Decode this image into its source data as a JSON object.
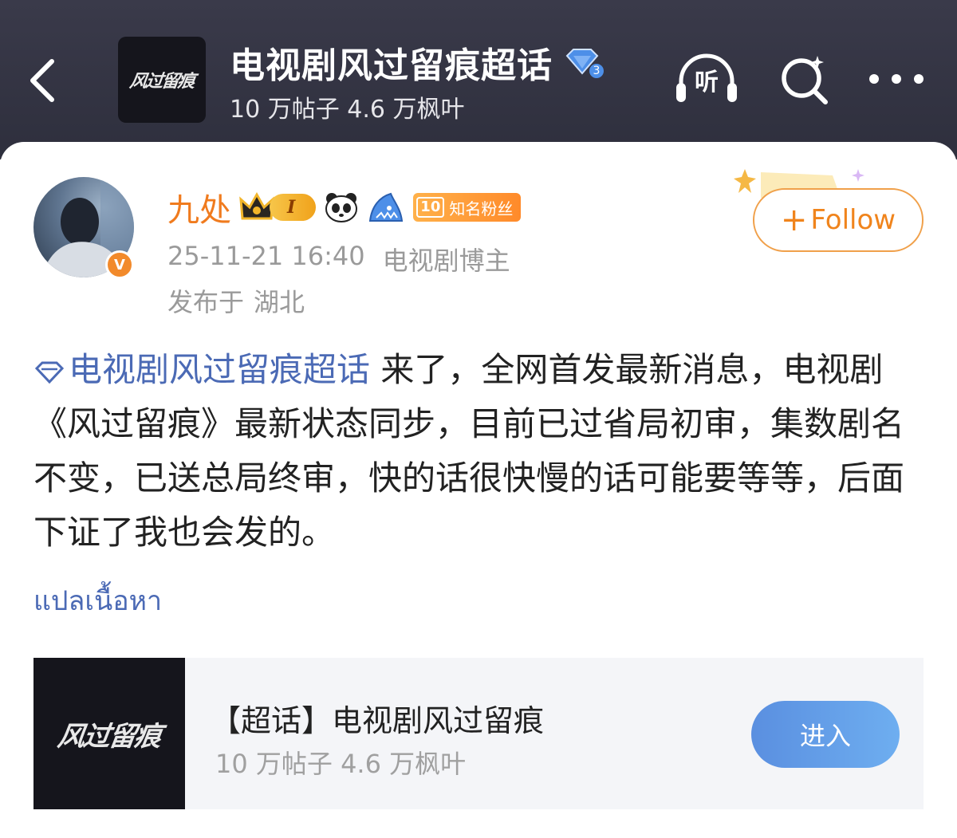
{
  "header": {
    "logo_text": "风过留痕",
    "title": "电视剧风过留痕超话",
    "level_badge": "3",
    "stats": "10 万帖子 4.6 万枫叶"
  },
  "post": {
    "author": "九处",
    "crown_level": "I",
    "fan_badge_level": "10",
    "fan_badge_label": "知名粉丝",
    "verified_mark": "V",
    "timestamp": "25-11-21 16:40",
    "author_tag": "电视剧博主",
    "location_prefix": "发布于",
    "location": "湖北",
    "follow_plus": "+",
    "follow_label": "Follow",
    "topic_link": "电视剧风过留痕超话",
    "body": " 来了，全网首发最新消息，电视剧《风过留痕》最新状态同步，目前已过省局初审，集数剧名不变，已送总局终审，快的话很快慢的话可能要等等，后面下证了我也会发的。",
    "translate_label": "แปลเนื้อหา"
  },
  "topic_card": {
    "logo_text": "风过留痕",
    "title": "【超话】电视剧风过留痕",
    "stats": "10 万帖子 4.6 万枫叶",
    "enter_label": "进入"
  },
  "icons": {
    "back": "chevron-left-icon",
    "listen": "headphones-icon",
    "listen_char": "听",
    "search": "search-icon",
    "more": "more-icon"
  },
  "colors": {
    "header_bg": "#2e2f3d",
    "username": "#f07b1e",
    "link": "#4b6ab5",
    "follow": "#f0841c",
    "enter_button": "#5a8fe0"
  }
}
